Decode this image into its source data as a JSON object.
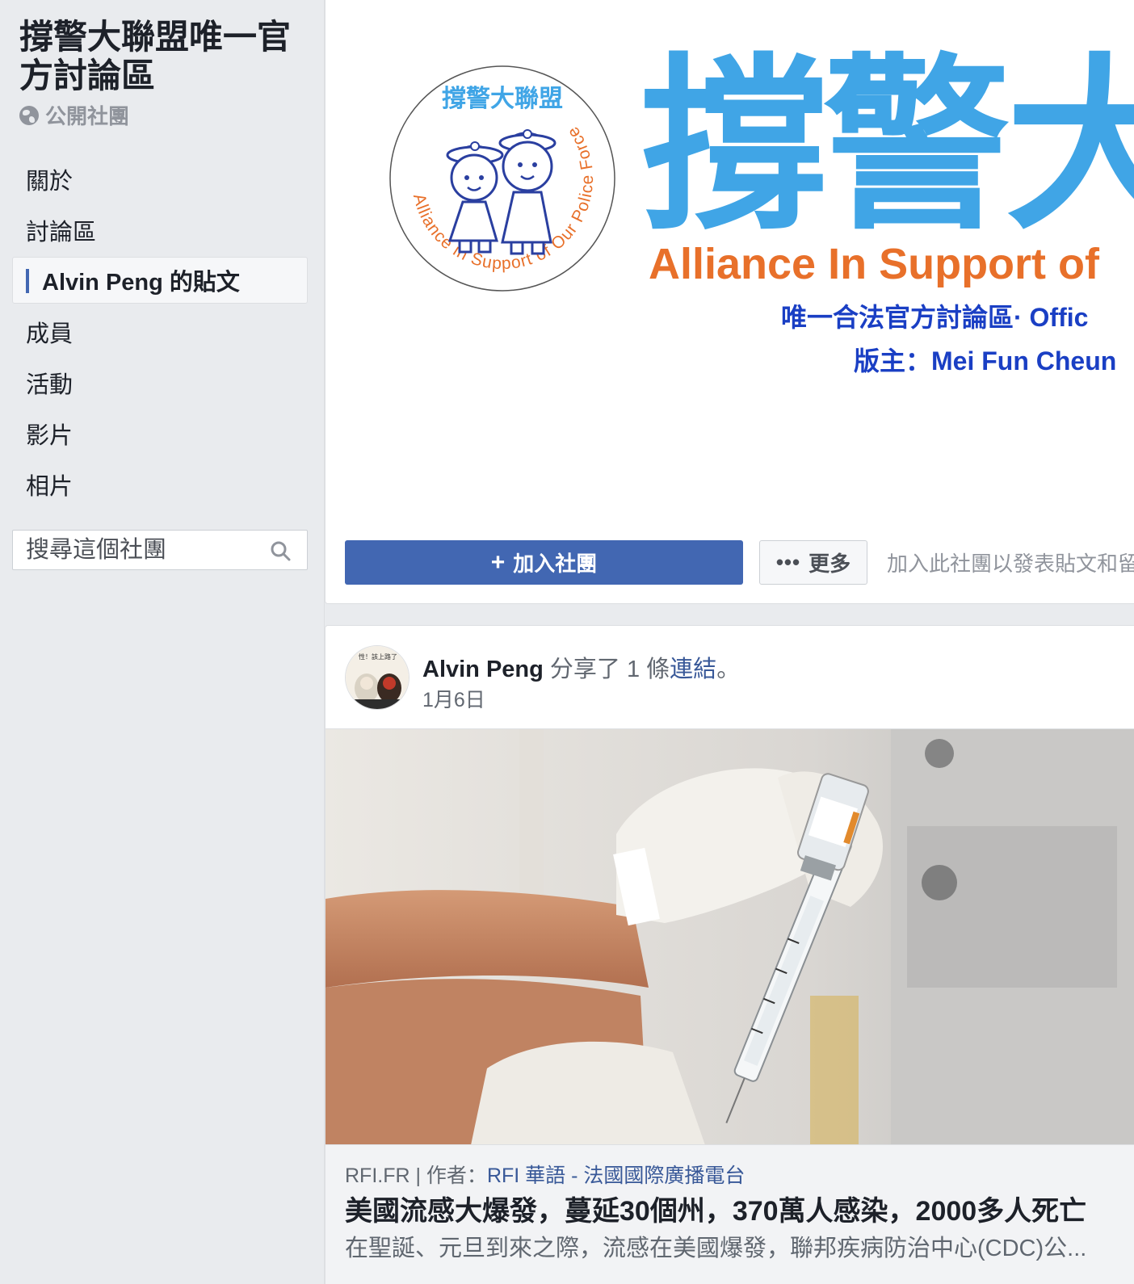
{
  "sidebar": {
    "group_name": "撐警大聯盟唯一官方討論區",
    "privacy_label": "公開社團",
    "nav": [
      {
        "label": "關於"
      },
      {
        "label": "討論區"
      },
      {
        "label": "Alvin Peng 的貼文",
        "active": true
      },
      {
        "label": "成員"
      },
      {
        "label": "活動"
      },
      {
        "label": "影片"
      },
      {
        "label": "相片"
      }
    ],
    "search_placeholder": "搜尋這個社團",
    "search_icon": "search-icon"
  },
  "cover": {
    "logo_top_text": "撐警大聯盟",
    "logo_ring_text": "Alliance in Support of Our Police Force",
    "big_title": "撐警大",
    "english_title": "Alliance In Support of",
    "subtitle_1": "唯一合法官方討論區· Offic",
    "subtitle_2": "版主：Mei Fun Cheun"
  },
  "actions": {
    "join_label": "加入社團",
    "more_label": "更多",
    "join_hint": "加入此社團以發表貼文和留"
  },
  "post": {
    "author": "Alvin Peng",
    "action_text": " 分享了 1 條",
    "link_text": "連結",
    "suffix": "。",
    "date": "1月6日",
    "avatar_caption": "性！該上路了",
    "preview": {
      "domain": "RFI.FR",
      "separator": " | 作者：",
      "author": "RFI 華語 - 法國國際廣播電台",
      "title": "美國流感大爆發，蔓延30個州，370萬人感染，2000多人死亡",
      "description": "在聖誕、元旦到來之際，流感在美國爆發，聯邦疾病防治中心(CDC)公..."
    }
  },
  "colors": {
    "brand_blue": "#4267b2",
    "cover_blue": "#40a5e6",
    "cover_orange": "#e8702a",
    "cover_navy": "#1a3fc4"
  }
}
